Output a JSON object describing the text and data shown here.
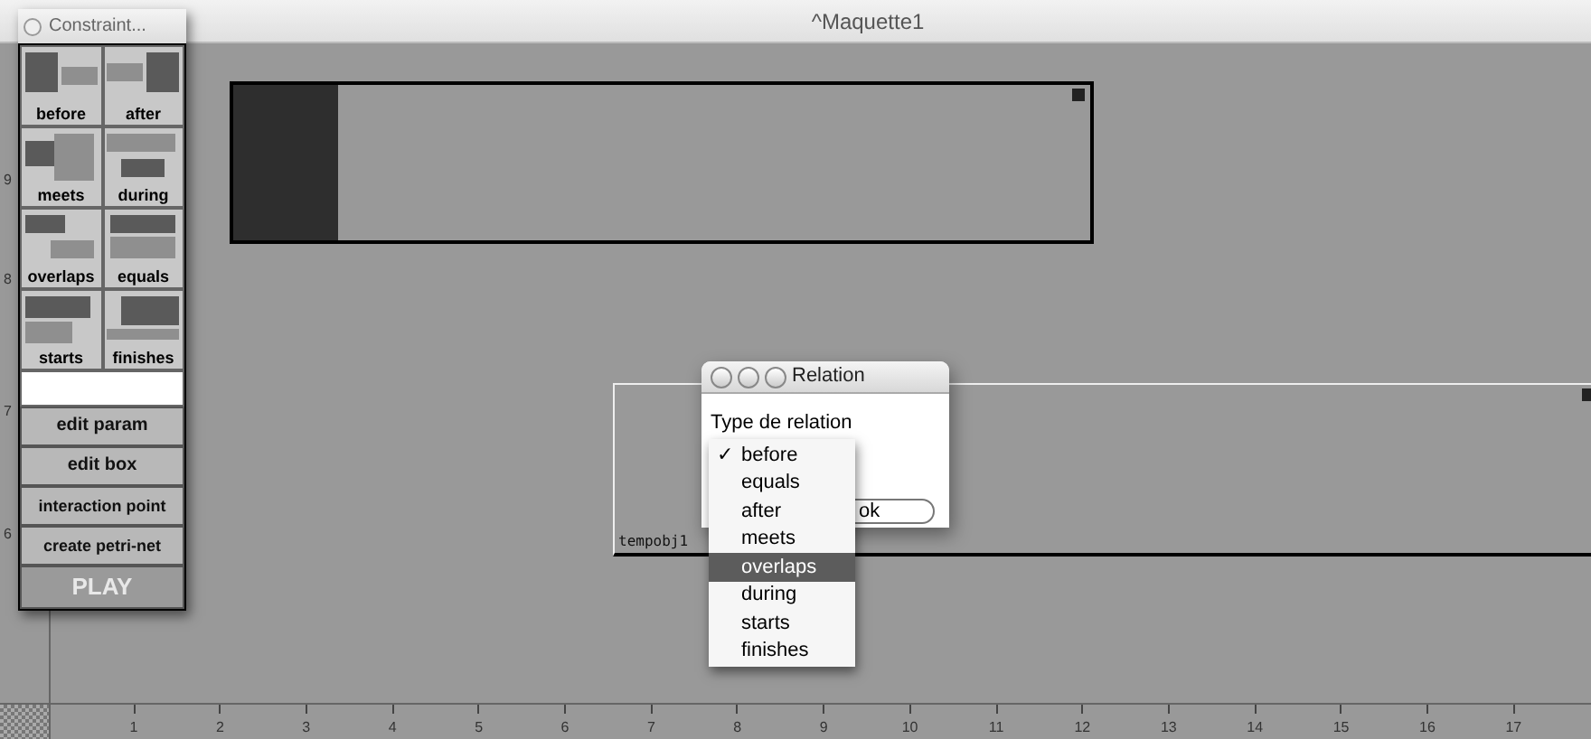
{
  "window": {
    "title": "^Maquette1"
  },
  "palette": {
    "title": "Constraint...",
    "relations": [
      {
        "label": "before",
        "kind": "before"
      },
      {
        "label": "after",
        "kind": "after"
      },
      {
        "label": "meets",
        "kind": "meets"
      },
      {
        "label": "during",
        "kind": "during"
      },
      {
        "label": "overlaps",
        "kind": "overlaps"
      },
      {
        "label": "equals",
        "kind": "equals"
      },
      {
        "label": "starts",
        "kind": "starts"
      },
      {
        "label": "finishes",
        "kind": "finishes"
      }
    ],
    "buttons": [
      {
        "label": "edit param",
        "disabled": false
      },
      {
        "label": "edit box",
        "disabled": false
      },
      {
        "label": "interaction point",
        "disabled": false
      },
      {
        "label": "create petri-net",
        "disabled": false
      },
      {
        "label": "PLAY",
        "disabled": true
      }
    ]
  },
  "boxes": [
    {
      "start_block": true
    },
    {
      "label": "tempobj1",
      "start_block": false
    }
  ],
  "vertical_ruler": [
    "9",
    "8",
    "7",
    "6"
  ],
  "horizontal_ruler": [
    "1",
    "2",
    "3",
    "4",
    "5",
    "6",
    "7",
    "8",
    "9",
    "10",
    "11",
    "12",
    "13",
    "14",
    "15",
    "16",
    "17"
  ],
  "dialog": {
    "title": "Relation",
    "prompt": "Type de relation",
    "ok": "ok",
    "menu": [
      {
        "label": "before",
        "checked": true,
        "selected": false
      },
      {
        "label": "equals",
        "checked": false,
        "selected": false
      },
      {
        "label": "after",
        "checked": false,
        "selected": false
      },
      {
        "label": "meets",
        "checked": false,
        "selected": false
      },
      {
        "label": "overlaps",
        "checked": false,
        "selected": true
      },
      {
        "label": "during",
        "checked": false,
        "selected": false
      },
      {
        "label": "starts",
        "checked": false,
        "selected": false
      },
      {
        "label": "finishes",
        "checked": false,
        "selected": false
      }
    ],
    "check_mark": "✓"
  }
}
